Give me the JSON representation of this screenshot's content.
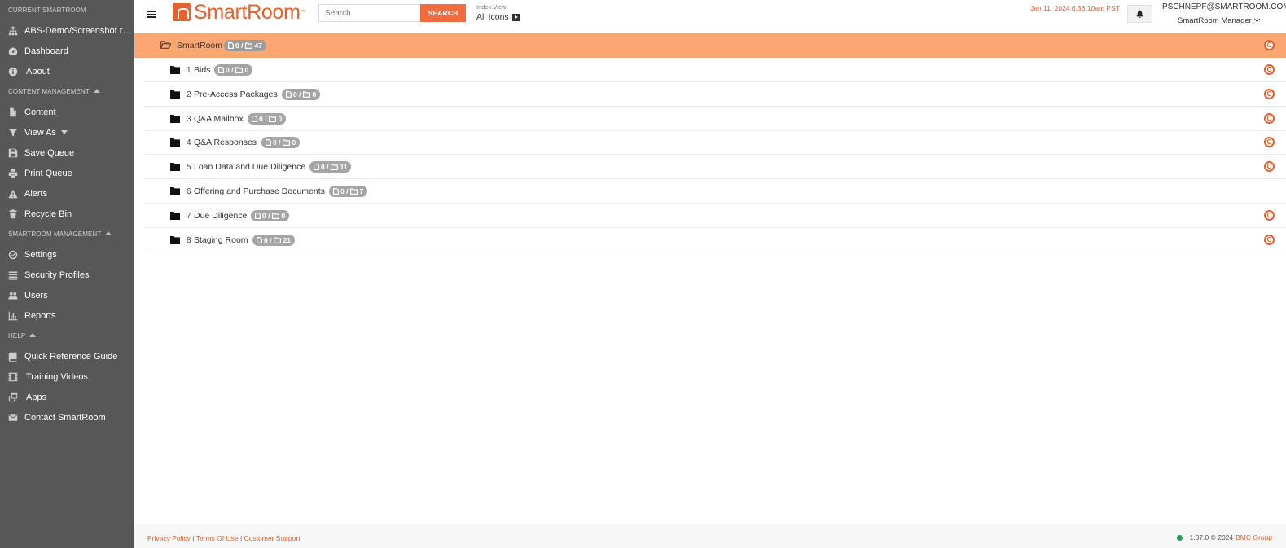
{
  "sidebar": {
    "current_smartroom": {
      "section_label": "CURRENT SMARTROOM",
      "items": [
        {
          "label": "ABS-Demo/Screenshot ro...",
          "icon": "sitemap-icon"
        },
        {
          "label": "Dashboard",
          "icon": "dashboard-icon"
        },
        {
          "label": "About",
          "icon": "info-icon"
        }
      ]
    },
    "content_management": {
      "section_label": "CONTENT MANAGEMENT",
      "items": [
        {
          "label": "Content",
          "icon": "file-icon"
        },
        {
          "label": "View As",
          "icon": "filter-icon"
        },
        {
          "label": "Save Queue",
          "icon": "save-icon"
        },
        {
          "label": "Print Queue",
          "icon": "print-icon"
        },
        {
          "label": "Alerts",
          "icon": "warning-icon"
        },
        {
          "label": "Recycle Bin",
          "icon": "trash-icon"
        }
      ]
    },
    "smartroom_management": {
      "section_label": "SMARTROOM MANAGEMENT",
      "items": [
        {
          "label": "Settings",
          "icon": "check-circle-icon"
        },
        {
          "label": "Security Profiles",
          "icon": "list-icon"
        },
        {
          "label": "Users",
          "icon": "users-icon"
        },
        {
          "label": "Reports",
          "icon": "bar-chart-icon"
        }
      ]
    },
    "help": {
      "section_label": "HELP",
      "items": [
        {
          "label": "Quick Reference Guide",
          "icon": "book-icon"
        },
        {
          "label": "Training Videos",
          "icon": "film-icon"
        },
        {
          "label": "Apps",
          "icon": "windows-icon"
        },
        {
          "label": "Contact SmartRoom",
          "icon": "envelope-icon"
        }
      ]
    }
  },
  "header": {
    "logo_text": "SmartRoom",
    "logo_tm": "™",
    "search_placeholder": "Search",
    "search_button": "SEARCH",
    "index_view_label": "Index View",
    "index_view_value": "All Icons",
    "datetime": "Jan 11, 2024 6:36:10am PST",
    "user_email": "PSCHNEPF@SMARTROOM.COM",
    "user_role": "SmartRoom Manager"
  },
  "tree": {
    "root": {
      "name": "SmartRoom",
      "files": "0",
      "folders": "47"
    },
    "folders": [
      {
        "num": "1",
        "name": "Bids",
        "files": "0",
        "folders": "0",
        "has_c": true
      },
      {
        "num": "2",
        "name": "Pre-Access Packages",
        "files": "0",
        "folders": "0",
        "has_c": true
      },
      {
        "num": "3",
        "name": "Q&A Mailbox",
        "files": "0",
        "folders": "0",
        "has_c": true
      },
      {
        "num": "4",
        "name": "Q&A Responses",
        "files": "0",
        "folders": "0",
        "has_c": true
      },
      {
        "num": "5",
        "name": "Loan Data and Due Diligence",
        "files": "0",
        "folders": "11",
        "has_c": true
      },
      {
        "num": "6",
        "name": "Offering and Purchase Documents",
        "files": "0",
        "folders": "7",
        "has_c": false
      },
      {
        "num": "7",
        "name": "Due Diligence",
        "files": "0",
        "folders": "0",
        "has_c": true
      },
      {
        "num": "8",
        "name": "Staging Room",
        "files": "0",
        "folders": "21",
        "has_c": true
      }
    ]
  },
  "footer": {
    "privacy": "Privacy Policy",
    "sep1": " | ",
    "terms": "Terms Of Use",
    "sep2": " | ",
    "support": "Customer Support",
    "version": "1.37.0 © 2024",
    "company": "BMC Group"
  },
  "colors": {
    "accent": "#e8602c",
    "selected_row": "#fca671",
    "sidebar_bg": "#575757",
    "status_ok": "#1e9e57"
  }
}
